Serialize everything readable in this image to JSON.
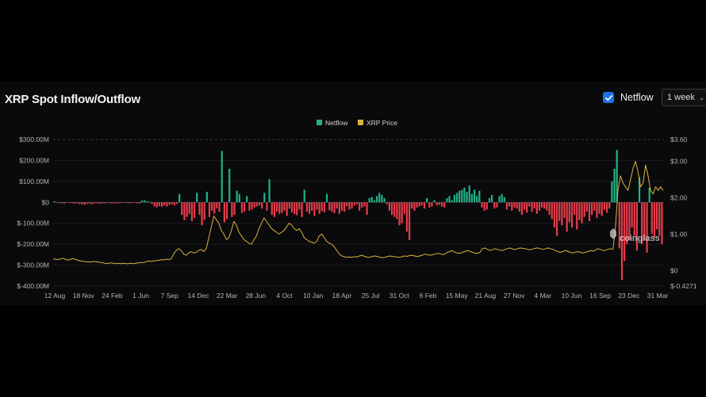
{
  "header": {
    "title": "XRP Spot Inflow/Outflow",
    "netflow_label": "Netflow",
    "netflow_checked": true,
    "period": "1 week"
  },
  "watermark": "coinglass",
  "colors": {
    "positive": "#1fb386",
    "negative": "#e83c4a",
    "price": "#d9b43a",
    "accent": "#1e72e8"
  },
  "chart_data": {
    "type": "bar",
    "title": "",
    "legend": [
      "Netflow",
      "XRP Price"
    ],
    "legend_position": "top-center",
    "grid": true,
    "x_ticks": [
      "12 Aug",
      "18 Nov",
      "24 Feb",
      "1 Jun",
      "7 Sep",
      "14 Dec",
      "22 Mar",
      "28 Jun",
      "4 Oct",
      "10 Jan",
      "18 Apr",
      "25 Jul",
      "31 Oct",
      "6 Feb",
      "15 May",
      "21 Aug",
      "27 Nov",
      "4 Mar",
      "10 Jun",
      "16 Sep",
      "23 Dec",
      "31 Mar"
    ],
    "y_left_ticks": [
      "$300.00M",
      "$200.00M",
      "$100.00M",
      "$0",
      "$-100.00M",
      "$-200.00M",
      "$-300.00M",
      "$-400.00M"
    ],
    "y_left_range": [
      -400,
      300
    ],
    "y_right_ticks": [
      "$3.60",
      "$3.00",
      "$2.00",
      "$1.00",
      "$0",
      "$-0.4271"
    ],
    "y_right_range": [
      -0.4271,
      3.6
    ],
    "netflow_series": {
      "name": "Netflow",
      "unit": "USD millions (weekly)",
      "values": [
        5,
        -3,
        -4,
        -5,
        -6,
        2,
        -3,
        -4,
        -6,
        -5,
        -8,
        -10,
        -12,
        -8,
        -6,
        -9,
        -5,
        -4,
        -7,
        -6,
        -5,
        -4,
        -3,
        -6,
        -5,
        -5,
        -4,
        -3,
        -2,
        -4,
        -5,
        -3,
        -3,
        -4,
        -6,
        8,
        10,
        5,
        3,
        -8,
        -20,
        -24,
        -18,
        -22,
        -15,
        -20,
        -12,
        -10,
        -15,
        -8,
        40,
        -60,
        -85,
        -70,
        -55,
        -90,
        -75,
        45,
        -60,
        -110,
        -85,
        50,
        -70,
        -40,
        -55,
        -30,
        -45,
        245,
        -95,
        -80,
        160,
        -70,
        -60,
        55,
        40,
        -50,
        -45,
        30,
        -40,
        -35,
        -25,
        -20,
        -15,
        -30,
        45,
        -40,
        110,
        -60,
        -70,
        -45,
        -55,
        -50,
        -40,
        -65,
        -30,
        -48,
        -56,
        -62,
        -35,
        -70,
        60,
        -45,
        -55,
        -40,
        -65,
        -35,
        -55,
        -42,
        -48,
        40,
        -38,
        -44,
        -52,
        -30,
        -55,
        -40,
        -45,
        -20,
        -35,
        -30,
        -15,
        -10,
        -40,
        -25,
        -20,
        -60,
        20,
        25,
        10,
        30,
        45,
        35,
        20,
        -10,
        -40,
        -60,
        -70,
        -80,
        -110,
        -100,
        -55,
        -140,
        -180,
        -30,
        -40,
        -25,
        -20,
        -15,
        -30,
        20,
        -25,
        -20,
        10,
        -15,
        -12,
        -20,
        -25,
        20,
        30,
        10,
        35,
        45,
        55,
        60,
        70,
        50,
        80,
        40,
        60,
        30,
        55,
        -25,
        -40,
        -35,
        20,
        35,
        -30,
        -25,
        30,
        40,
        25,
        -35,
        -20,
        -40,
        -25,
        -30,
        -45,
        -60,
        -35,
        -50,
        -20,
        -45,
        -30,
        -55,
        -40,
        -25,
        -30,
        -40,
        -60,
        -80,
        -120,
        -160,
        -90,
        -110,
        -75,
        -140,
        -95,
        -120,
        -60,
        -130,
        -85,
        -100,
        -70,
        -45,
        -90,
        -60,
        -40,
        -75,
        -55,
        -65,
        -35,
        -50,
        -30,
        100,
        160,
        250,
        -220,
        -370,
        -280,
        -200,
        -180,
        -120,
        -160,
        -230,
        120,
        -200,
        -180,
        -240,
        70,
        -150,
        -170,
        -130,
        -160,
        -200
      ]
    },
    "price_series": {
      "name": "XRP Price",
      "unit": "USD",
      "values": [
        0.32,
        0.31,
        0.3,
        0.32,
        0.34,
        0.3,
        0.29,
        0.31,
        0.33,
        0.3,
        0.28,
        0.26,
        0.25,
        0.24,
        0.24,
        0.23,
        0.25,
        0.24,
        0.23,
        0.22,
        0.21,
        0.19,
        0.2,
        0.21,
        0.2,
        0.19,
        0.2,
        0.19,
        0.2,
        0.19,
        0.19,
        0.2,
        0.19,
        0.2,
        0.21,
        0.22,
        0.22,
        0.24,
        0.26,
        0.25,
        0.26,
        0.27,
        0.28,
        0.3,
        0.29,
        0.31,
        0.3,
        0.32,
        0.45,
        0.55,
        0.6,
        0.55,
        0.45,
        0.42,
        0.48,
        0.52,
        0.48,
        0.5,
        0.55,
        0.58,
        0.52,
        0.6,
        0.9,
        1.2,
        1.5,
        1.4,
        1.3,
        1.1,
        1.0,
        0.85,
        0.9,
        1.1,
        1.35,
        1.25,
        1.05,
        0.95,
        0.85,
        0.8,
        0.75,
        0.72,
        0.85,
        0.95,
        1.15,
        1.3,
        1.45,
        1.35,
        1.25,
        1.15,
        1.1,
        1.05,
        1.0,
        1.05,
        1.1,
        1.2,
        1.3,
        1.25,
        1.15,
        1.1,
        1.15,
        1.05,
        0.9,
        0.85,
        0.8,
        0.78,
        0.75,
        0.8,
        0.95,
        1.0,
        0.9,
        0.8,
        0.75,
        0.72,
        0.65,
        0.55,
        0.45,
        0.4,
        0.38,
        0.36,
        0.37,
        0.36,
        0.38,
        0.37,
        0.4,
        0.42,
        0.39,
        0.37,
        0.36,
        0.38,
        0.4,
        0.39,
        0.37,
        0.35,
        0.36,
        0.38,
        0.4,
        0.39,
        0.38,
        0.37,
        0.36,
        0.38,
        0.4,
        0.39,
        0.41,
        0.42,
        0.4,
        0.38,
        0.4,
        0.42,
        0.45,
        0.44,
        0.42,
        0.43,
        0.45,
        0.47,
        0.46,
        0.44,
        0.45,
        0.5,
        0.52,
        0.55,
        0.5,
        0.48,
        0.47,
        0.5,
        0.52,
        0.55,
        0.53,
        0.5,
        0.48,
        0.47,
        0.5,
        0.6,
        0.62,
        0.58,
        0.55,
        0.57,
        0.6,
        0.58,
        0.56,
        0.55,
        0.58,
        0.6,
        0.62,
        0.59,
        0.58,
        0.6,
        0.62,
        0.61,
        0.6,
        0.58,
        0.57,
        0.59,
        0.61,
        0.62,
        0.6,
        0.58,
        0.6,
        0.62,
        0.6,
        0.58,
        0.55,
        0.52,
        0.5,
        0.52,
        0.55,
        0.53,
        0.5,
        0.48,
        0.5,
        0.52,
        0.5,
        0.48,
        0.5,
        0.52,
        0.55,
        0.53,
        0.56,
        0.6,
        0.58,
        0.55,
        0.56,
        0.58,
        0.6,
        0.58,
        1.2,
        2.2,
        2.6,
        2.4,
        2.3,
        2.2,
        2.5,
        2.8,
        3.0,
        2.7,
        2.3,
        2.4,
        2.9,
        2.6,
        2.2,
        2.1,
        2.3,
        2.2,
        2.3,
        2.2
      ]
    }
  }
}
